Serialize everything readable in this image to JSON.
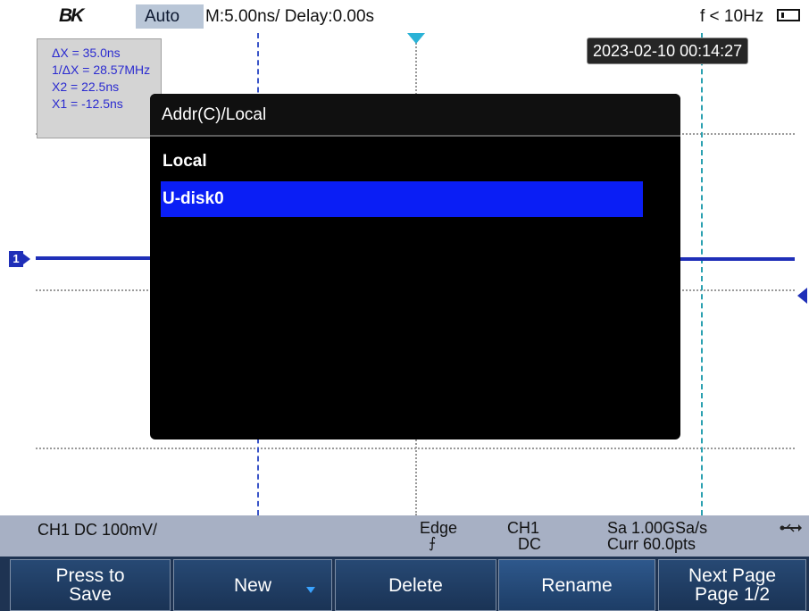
{
  "topbar": {
    "logo": "BK",
    "mode": "Auto",
    "timebase": "M:5.00ns/ Delay:0.00s",
    "frequency": "f < 10Hz"
  },
  "cursor_readout": {
    "delta_x": "ΔX = 35.0ns",
    "inv_delta_x": "1/ΔX = 28.57MHz",
    "x2": "X2 = 22.5ns",
    "x1": "X1 = -12.5ns"
  },
  "datetime": "2023-02-10 00:14:27",
  "channel_marker": "1",
  "dialog": {
    "title": "Addr(C)/Local",
    "items": [
      {
        "label": "Local",
        "selected": false
      },
      {
        "label": "U-disk0",
        "selected": true
      }
    ]
  },
  "status": {
    "ch1": "CH1 DC 100mV/",
    "trigger_type": "Edge",
    "trigger_slope": "⨍",
    "trigger_source": "CH1",
    "trigger_coupling": "DC",
    "sample_rate": "Sa 1.00GSa/s",
    "record": "Curr 60.0pts",
    "usb_icon": "usb-icon"
  },
  "softkeys": [
    {
      "label": "Press to\nSave"
    },
    {
      "label": "New"
    },
    {
      "label": "Delete"
    },
    {
      "label": "Rename"
    },
    {
      "label": "Next Page\nPage 1/2"
    }
  ],
  "colors": {
    "trace": "#1f2fb8",
    "selection": "#0a1ef5",
    "softkey_bg": "#1e3352",
    "status_bg": "#a7b0c4"
  }
}
